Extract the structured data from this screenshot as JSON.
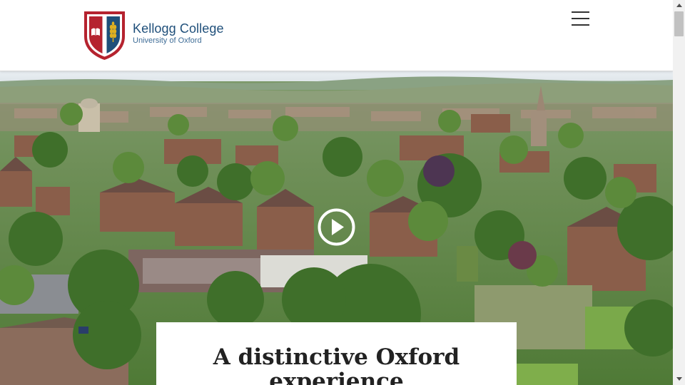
{
  "header": {
    "logo": {
      "title": "Kellogg College",
      "subtitle": "University of Oxford",
      "crest_colors": {
        "red": "#b5232f",
        "blue": "#1f4f7a",
        "gold": "#e0b020"
      }
    },
    "menu_icon": "hamburger-menu-icon"
  },
  "hero": {
    "media": "aerial-video-of-oxford",
    "play_icon": "play-icon",
    "caption": {
      "title_line1": "A distinctive Oxford",
      "title_line2": "experience"
    }
  },
  "scrollbar": {
    "up_icon": "scroll-up-arrow",
    "down_icon": "scroll-down-arrow"
  }
}
